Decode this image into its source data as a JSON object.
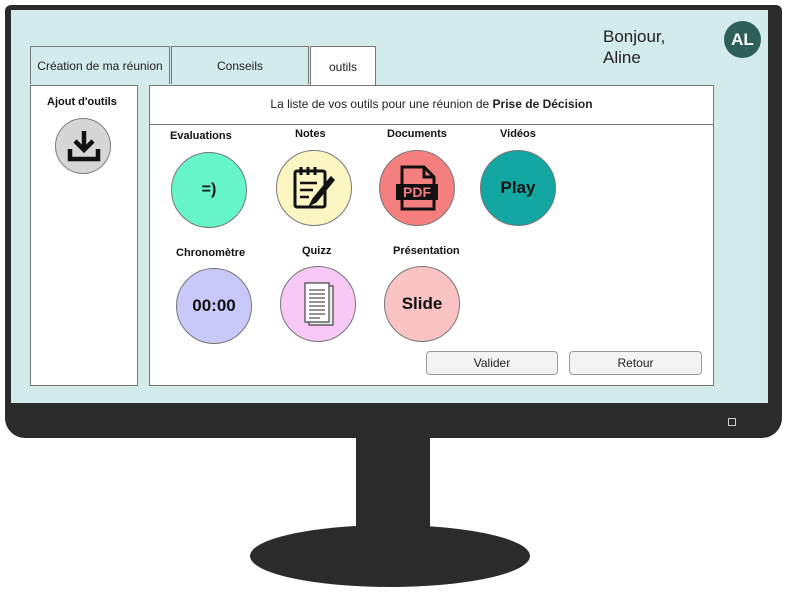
{
  "header": {
    "greeting_line1": "Bonjour,",
    "greeting_line2": "Aline",
    "avatar_initials": "AL"
  },
  "tabs": [
    {
      "label": "Création de ma réunion"
    },
    {
      "label": "Conseils"
    },
    {
      "label": "outils",
      "active": true
    }
  ],
  "sidebar": {
    "title": "Ajout d'outils",
    "icon": "download-icon"
  },
  "main": {
    "intro_prefix": "La liste de vos outils pour une réunion de ",
    "intro_bold": "Prise de Décision",
    "tools": [
      {
        "label": "Evaluations",
        "content": "=)",
        "color": "#66f5c8"
      },
      {
        "label": "Notes",
        "icon": "notepad-icon",
        "color": "#fbf6c2"
      },
      {
        "label": "Documents",
        "icon": "pdf-icon",
        "color": "#f57f7f"
      },
      {
        "label": "Vidéos",
        "content": "Play",
        "color": "#13a7a2"
      },
      {
        "label": "Chronomètre",
        "content": "00:00",
        "color": "#c8c9f9"
      },
      {
        "label": "Quizz",
        "icon": "document-icon",
        "color": "#f7c8f6"
      },
      {
        "label": "Présentation",
        "content": "Slide",
        "color": "#fac3c3"
      }
    ]
  },
  "actions": {
    "validate_label": "Valider",
    "back_label": "Retour"
  }
}
